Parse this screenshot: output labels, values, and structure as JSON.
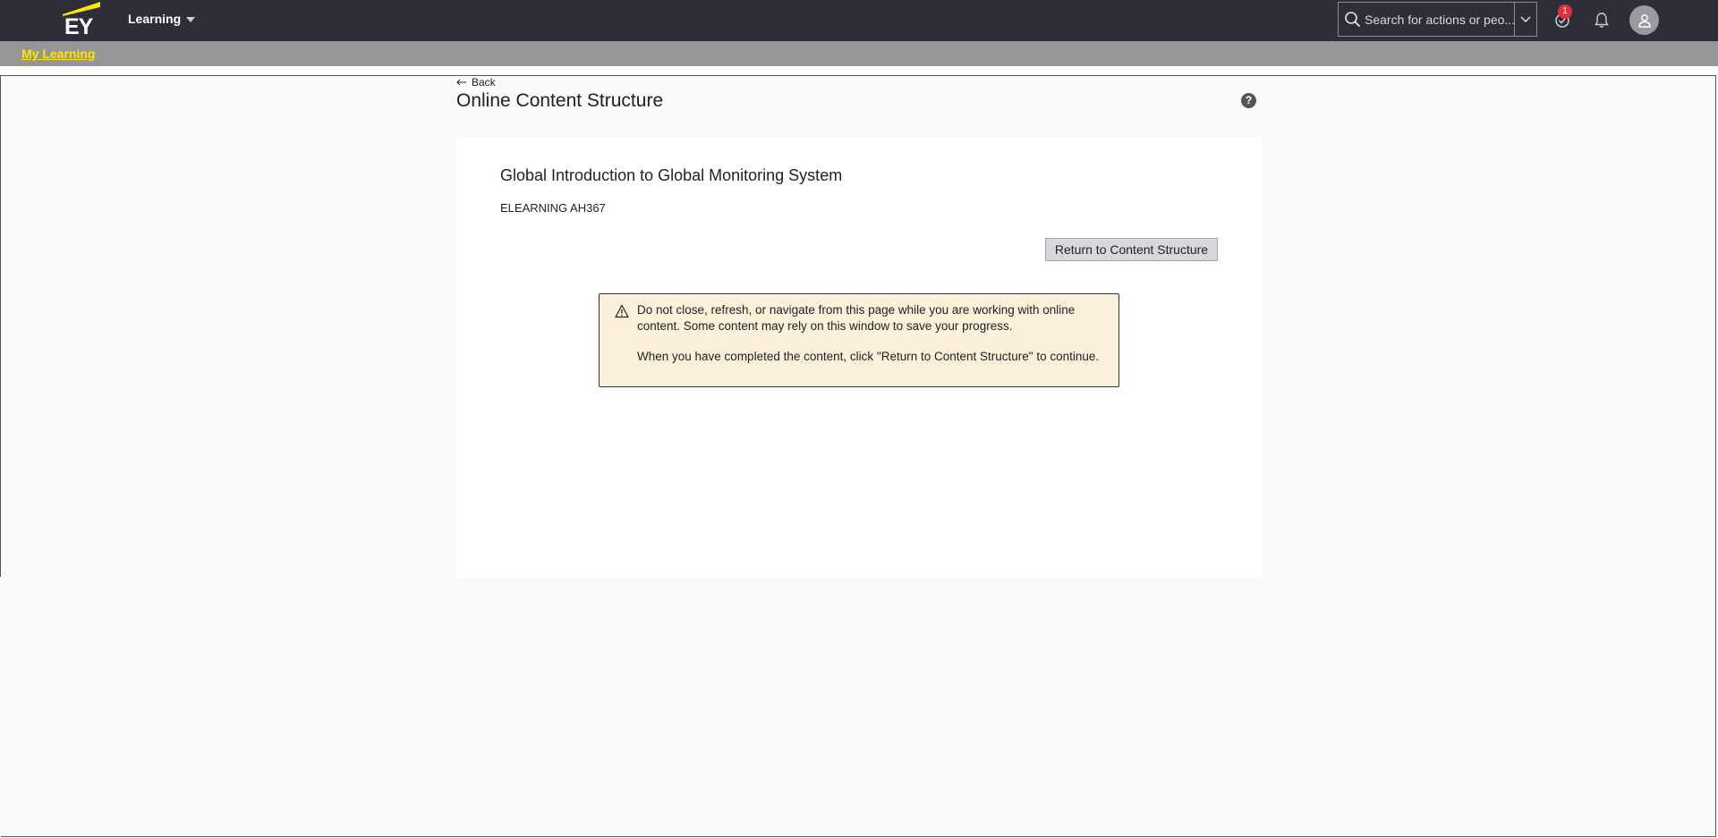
{
  "topbar": {
    "logo_text": "EY",
    "app_name": "Learning",
    "search_placeholder": "Search for actions or peo...",
    "tasks_badge": "1"
  },
  "subbar": {
    "link": "My Learning"
  },
  "page": {
    "back": "Back",
    "title": "Online Content Structure",
    "help": "?"
  },
  "course": {
    "title": "Global Introduction to Global Monitoring System",
    "code": "ELEARNING AH367",
    "return_button": "Return to Content Structure"
  },
  "warning": {
    "line1": "Do not close, refresh, or navigate from this page while you are working with online content. Some content may rely on this window to save your progress.",
    "line2": "When you have completed the content, click \"Return to Content Structure\" to continue."
  },
  "colors": {
    "header_bg": "#2e2e38",
    "subbar_bg": "#969698",
    "link_yellow": "#ffe600",
    "warning_bg": "#fdf0da"
  }
}
